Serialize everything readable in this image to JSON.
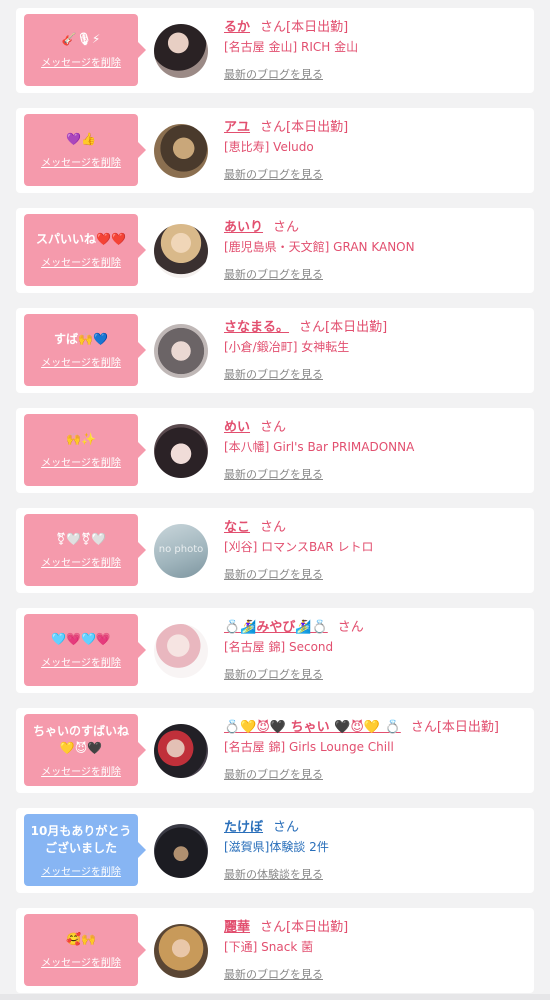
{
  "delete_label": "メッセージを削除",
  "san_label": "さん",
  "items": [
    {
      "message": "🎸🎙⚡",
      "name": "るか",
      "work": "[本日出勤]",
      "shop": "[名古屋 金山] RICH 金山",
      "blog": "最新のブログを見る"
    },
    {
      "message": "💜👍",
      "name": "アユ",
      "work": "[本日出勤]",
      "shop": "[恵比寿] Veludo",
      "blog": "最新のブログを見る"
    },
    {
      "message": "スパいいね❤️❤️",
      "name": "あいり",
      "work": "",
      "shop": "[鹿児島県・天文館] GRAN KANON",
      "blog": "最新のブログを見る"
    },
    {
      "message": "すば🙌💙",
      "name": "さなまる。",
      "work": "[本日出勤]",
      "shop": "[小倉/鍛冶町] 女神転生",
      "blog": "最新のブログを見る"
    },
    {
      "message": "🙌✨",
      "name": "めい",
      "work": "",
      "shop": "[本八幡] Girl's Bar PRIMADONNA",
      "blog": "最新のブログを見る"
    },
    {
      "message": "⚧🤍⚧🤍",
      "name": "なこ",
      "work": "",
      "shop": "[刈谷] ロマンスBAR レトロ",
      "blog": "最新のブログを見る",
      "avatar_text": "no photo"
    },
    {
      "message": "🩵💗🩵💗",
      "name": "💍🏄‍♀️みやび🏄‍♀️💍",
      "work": "",
      "shop": "[名古屋 錦] Second",
      "blog": "最新のブログを見る"
    },
    {
      "message": "ちゃいのすばいね\n💛😈🖤",
      "name": "💍💛😈🖤 ちゃい 🖤😈💛 💍",
      "work": "[本日出勤]",
      "shop": "[名古屋 錦] Girls Lounge Chill",
      "blog": "最新のブログを見る"
    },
    {
      "message": "10月もありがとう\nございました",
      "name": "たけぼ",
      "work": "",
      "shop": "[滋賀県]体験談 2件",
      "blog": "最新の体験談を見る"
    },
    {
      "message": "🥰🙌",
      "name": "麗華",
      "work": "[本日出勤]",
      "shop": "[下通] Snack 菌",
      "blog": "最新のブログを見る"
    }
  ],
  "colors": {
    "bubble_pink": "#f59aac",
    "bubble_blue": "#87b5f3",
    "name_pink": "#e24f6f",
    "name_blue": "#2a6fba",
    "link_gray": "#888888"
  }
}
